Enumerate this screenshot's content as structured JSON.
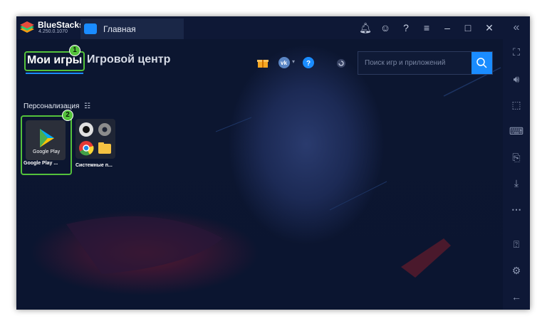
{
  "window": {
    "app_name": "BlueStacks",
    "version": "4.250.0.1070",
    "tab_title": "Главная"
  },
  "titlebar_icons": [
    "bell-icon",
    "account-icon",
    "help-icon",
    "menu-icon",
    "minimize-icon",
    "maximize-icon",
    "close-icon"
  ],
  "nav": {
    "my_games": "Мои игры",
    "game_center": "Игровой центр"
  },
  "badges": {
    "first": "1",
    "second": "2"
  },
  "search": {
    "placeholder": "Поиск игр и приложений"
  },
  "section": {
    "personalize": "Персонализация"
  },
  "apps": [
    {
      "label": "Google Play ...",
      "tile_text": "Google Play"
    },
    {
      "label": "Системные п..."
    }
  ],
  "sidebar_icons": [
    "collapse-icon",
    "fullscreen-icon",
    "volume-icon",
    "cursor-icon",
    "keyboard-icon",
    "apk-icon",
    "install-icon",
    "more-icon",
    "help-icon",
    "settings-icon",
    "back-icon"
  ],
  "colors": {
    "accent": "#1a8cff",
    "highlight": "#54c23b",
    "background": "#0c1630"
  }
}
